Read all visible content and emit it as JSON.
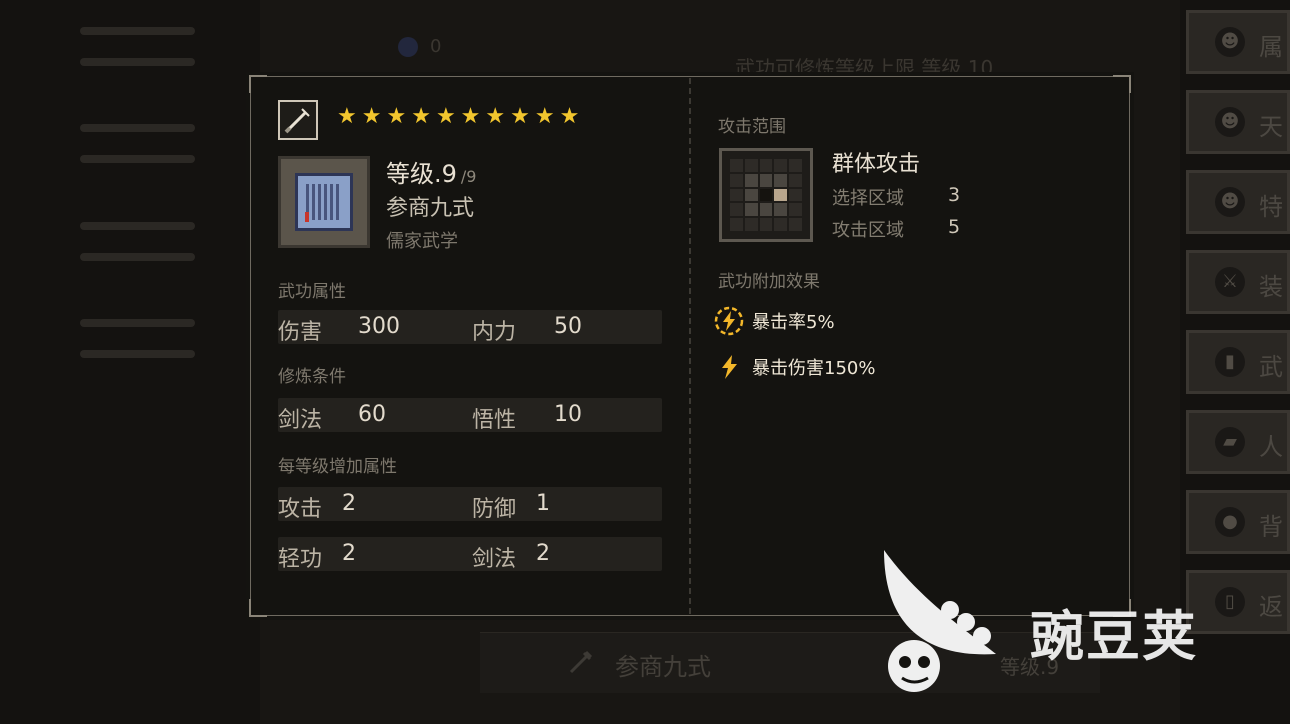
{
  "background": {
    "top_value": "0",
    "top_text": "武功可修炼等级上限 等级 10",
    "bottom_bar": {
      "skill_name": "参商九式",
      "level": "等级.9"
    },
    "side_tabs": [
      "属",
      "天",
      "特",
      "装",
      "武",
      "人",
      "背",
      "返"
    ]
  },
  "popup": {
    "weapon_type_icon": "sword-icon",
    "stars": 10,
    "level_label": "等级.9",
    "level_max": "/9",
    "skill_name": "参商九式",
    "school": "儒家武学",
    "attr_title": "武功属性",
    "attrs": [
      {
        "label": "伤害",
        "value": "300"
      },
      {
        "label": "内力",
        "value": "50"
      }
    ],
    "req_title": "修炼条件",
    "reqs": [
      {
        "label": "剑法",
        "value": "60"
      },
      {
        "label": "悟性",
        "value": "10"
      }
    ],
    "per_level_title": "每等级增加属性",
    "per_level": [
      {
        "label": "攻击",
        "value": "2"
      },
      {
        "label": "防御",
        "value": "1"
      },
      {
        "label": "轻功",
        "value": "2"
      },
      {
        "label": "剑法",
        "value": "2"
      }
    ],
    "range_title": "攻击范围",
    "attack_type": "群体攻击",
    "select_area_label": "选择区域",
    "select_area_value": "3",
    "attack_area_label": "攻击区域",
    "attack_area_value": "5",
    "effects_title": "武功附加效果",
    "effects": [
      {
        "icon": "lightning-circle-icon",
        "text": "暴击率5%"
      },
      {
        "icon": "lightning-icon",
        "text": "暴击伤害150%"
      }
    ]
  },
  "watermark": {
    "text": "豌豆荚"
  },
  "colors": {
    "star": "#f2c62e",
    "bg": "#141310",
    "border": "#6f6a60",
    "lightning": "#f3b72a"
  }
}
